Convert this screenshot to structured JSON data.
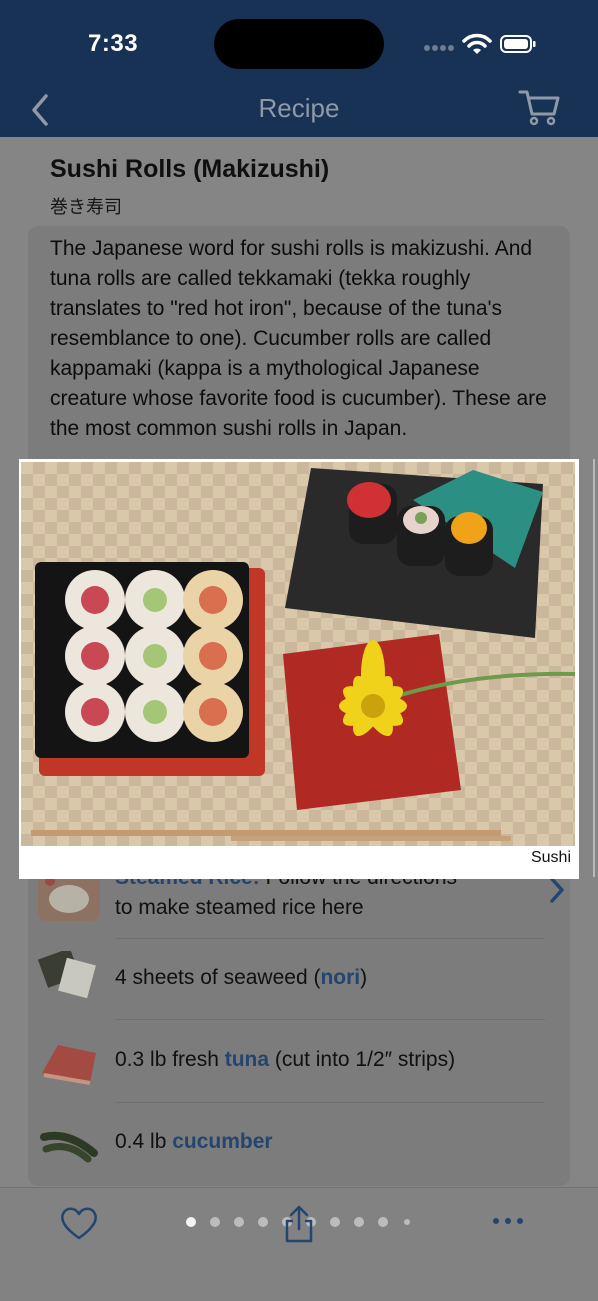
{
  "status": {
    "time": "7:33"
  },
  "nav": {
    "title": "Recipe"
  },
  "recipe": {
    "title": "Sushi Rolls (Makizushi)",
    "subtitle": "巻き寿司",
    "description": "The Japanese word for sushi rolls is makizushi. And tuna rolls are called tekkamaki (tekka roughly translates to \"red hot iron\", because of the tuna's resemblance to one). Cucumber rolls are called kappamaki (kappa is a mythological Japanese creature whose favorite food is cucumber). These are the most common sushi rolls in Japan."
  },
  "photo": {
    "caption": "Sushi"
  },
  "ingredients": [
    {
      "link": "Steamed Rice:",
      "text": "Follow the directions",
      "line2": "to make steamed rice here",
      "icon": "rice-thumbnail"
    },
    {
      "prefix": "4 sheets of seaweed (",
      "link": "nori",
      "suffix": ")",
      "icon": "nori-thumbnail"
    },
    {
      "prefix": "0.3 lb fresh ",
      "link": "tuna",
      "suffix": " (cut into 1/2″ strips)",
      "icon": "tuna-thumbnail"
    },
    {
      "prefix": "0.4 lb ",
      "link": "cucumber",
      "suffix": "",
      "icon": "cucumber-thumbnail"
    }
  ],
  "colors": {
    "nav_bg": "#173254",
    "link": "#24456e",
    "dim_overlay": "#858585"
  },
  "pager": {
    "page_count": 10,
    "current_page": 1
  }
}
